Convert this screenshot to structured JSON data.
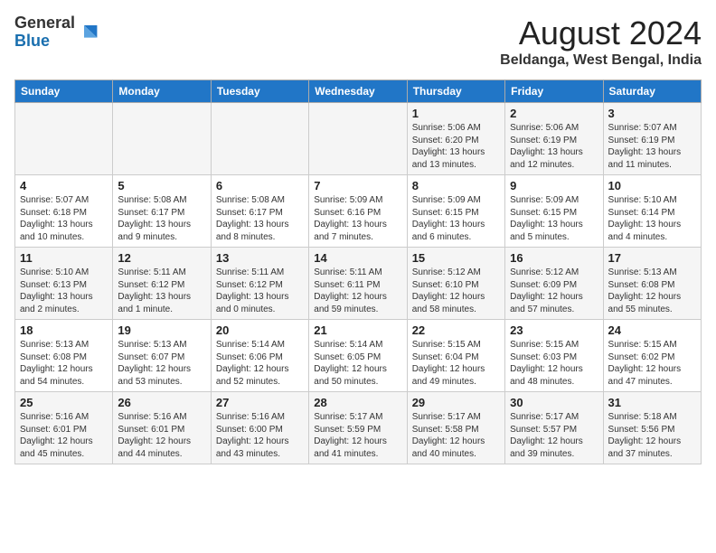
{
  "header": {
    "logo_general": "General",
    "logo_blue": "Blue",
    "month_title": "August 2024",
    "location": "Beldanga, West Bengal, India"
  },
  "calendar": {
    "days_of_week": [
      "Sunday",
      "Monday",
      "Tuesday",
      "Wednesday",
      "Thursday",
      "Friday",
      "Saturday"
    ],
    "weeks": [
      [
        {
          "num": "",
          "info": ""
        },
        {
          "num": "",
          "info": ""
        },
        {
          "num": "",
          "info": ""
        },
        {
          "num": "",
          "info": ""
        },
        {
          "num": "1",
          "info": "Sunrise: 5:06 AM\nSunset: 6:20 PM\nDaylight: 13 hours\nand 13 minutes."
        },
        {
          "num": "2",
          "info": "Sunrise: 5:06 AM\nSunset: 6:19 PM\nDaylight: 13 hours\nand 12 minutes."
        },
        {
          "num": "3",
          "info": "Sunrise: 5:07 AM\nSunset: 6:19 PM\nDaylight: 13 hours\nand 11 minutes."
        }
      ],
      [
        {
          "num": "4",
          "info": "Sunrise: 5:07 AM\nSunset: 6:18 PM\nDaylight: 13 hours\nand 10 minutes."
        },
        {
          "num": "5",
          "info": "Sunrise: 5:08 AM\nSunset: 6:17 PM\nDaylight: 13 hours\nand 9 minutes."
        },
        {
          "num": "6",
          "info": "Sunrise: 5:08 AM\nSunset: 6:17 PM\nDaylight: 13 hours\nand 8 minutes."
        },
        {
          "num": "7",
          "info": "Sunrise: 5:09 AM\nSunset: 6:16 PM\nDaylight: 13 hours\nand 7 minutes."
        },
        {
          "num": "8",
          "info": "Sunrise: 5:09 AM\nSunset: 6:15 PM\nDaylight: 13 hours\nand 6 minutes."
        },
        {
          "num": "9",
          "info": "Sunrise: 5:09 AM\nSunset: 6:15 PM\nDaylight: 13 hours\nand 5 minutes."
        },
        {
          "num": "10",
          "info": "Sunrise: 5:10 AM\nSunset: 6:14 PM\nDaylight: 13 hours\nand 4 minutes."
        }
      ],
      [
        {
          "num": "11",
          "info": "Sunrise: 5:10 AM\nSunset: 6:13 PM\nDaylight: 13 hours\nand 2 minutes."
        },
        {
          "num": "12",
          "info": "Sunrise: 5:11 AM\nSunset: 6:12 PM\nDaylight: 13 hours\nand 1 minute."
        },
        {
          "num": "13",
          "info": "Sunrise: 5:11 AM\nSunset: 6:12 PM\nDaylight: 13 hours\nand 0 minutes."
        },
        {
          "num": "14",
          "info": "Sunrise: 5:11 AM\nSunset: 6:11 PM\nDaylight: 12 hours\nand 59 minutes."
        },
        {
          "num": "15",
          "info": "Sunrise: 5:12 AM\nSunset: 6:10 PM\nDaylight: 12 hours\nand 58 minutes."
        },
        {
          "num": "16",
          "info": "Sunrise: 5:12 AM\nSunset: 6:09 PM\nDaylight: 12 hours\nand 57 minutes."
        },
        {
          "num": "17",
          "info": "Sunrise: 5:13 AM\nSunset: 6:08 PM\nDaylight: 12 hours\nand 55 minutes."
        }
      ],
      [
        {
          "num": "18",
          "info": "Sunrise: 5:13 AM\nSunset: 6:08 PM\nDaylight: 12 hours\nand 54 minutes."
        },
        {
          "num": "19",
          "info": "Sunrise: 5:13 AM\nSunset: 6:07 PM\nDaylight: 12 hours\nand 53 minutes."
        },
        {
          "num": "20",
          "info": "Sunrise: 5:14 AM\nSunset: 6:06 PM\nDaylight: 12 hours\nand 52 minutes."
        },
        {
          "num": "21",
          "info": "Sunrise: 5:14 AM\nSunset: 6:05 PM\nDaylight: 12 hours\nand 50 minutes."
        },
        {
          "num": "22",
          "info": "Sunrise: 5:15 AM\nSunset: 6:04 PM\nDaylight: 12 hours\nand 49 minutes."
        },
        {
          "num": "23",
          "info": "Sunrise: 5:15 AM\nSunset: 6:03 PM\nDaylight: 12 hours\nand 48 minutes."
        },
        {
          "num": "24",
          "info": "Sunrise: 5:15 AM\nSunset: 6:02 PM\nDaylight: 12 hours\nand 47 minutes."
        }
      ],
      [
        {
          "num": "25",
          "info": "Sunrise: 5:16 AM\nSunset: 6:01 PM\nDaylight: 12 hours\nand 45 minutes."
        },
        {
          "num": "26",
          "info": "Sunrise: 5:16 AM\nSunset: 6:01 PM\nDaylight: 12 hours\nand 44 minutes."
        },
        {
          "num": "27",
          "info": "Sunrise: 5:16 AM\nSunset: 6:00 PM\nDaylight: 12 hours\nand 43 minutes."
        },
        {
          "num": "28",
          "info": "Sunrise: 5:17 AM\nSunset: 5:59 PM\nDaylight: 12 hours\nand 41 minutes."
        },
        {
          "num": "29",
          "info": "Sunrise: 5:17 AM\nSunset: 5:58 PM\nDaylight: 12 hours\nand 40 minutes."
        },
        {
          "num": "30",
          "info": "Sunrise: 5:17 AM\nSunset: 5:57 PM\nDaylight: 12 hours\nand 39 minutes."
        },
        {
          "num": "31",
          "info": "Sunrise: 5:18 AM\nSunset: 5:56 PM\nDaylight: 12 hours\nand 37 minutes."
        }
      ]
    ]
  }
}
